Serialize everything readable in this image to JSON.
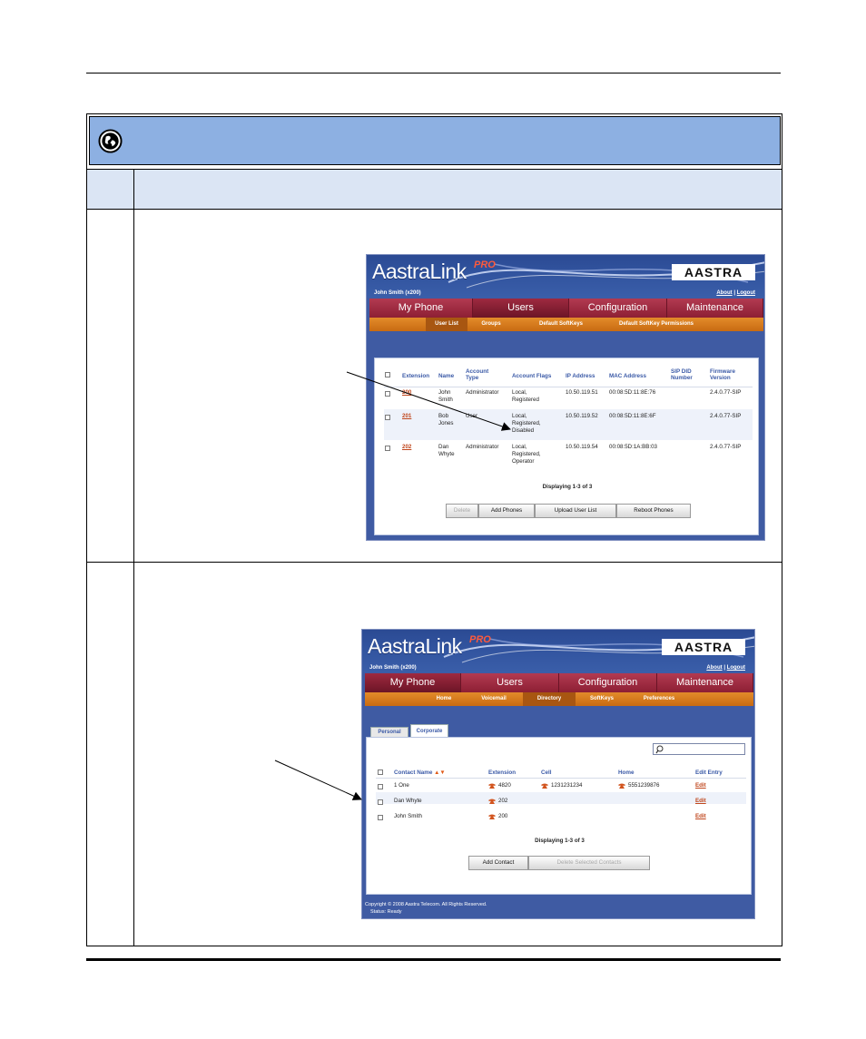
{
  "shot1": {
    "logo": "AastraLink",
    "logo_pro": "PRO",
    "brand": "AASTRA",
    "user": "John Smith (x200)",
    "about": "About",
    "sep": "|",
    "logout": "Logout",
    "nav": [
      "My Phone",
      "Users",
      "Configuration",
      "Maintenance"
    ],
    "subnav": [
      "User List",
      "Groups",
      "Default SoftKeys",
      "Default SoftKey Permissions"
    ],
    "columns": [
      "Extension",
      "Name",
      "Account Type",
      "Account Flags",
      "IP Address",
      "MAC Address",
      "SIP DID Number",
      "Firmware Version"
    ],
    "rows": [
      {
        "ext": "200",
        "name": "John Smith",
        "type": "Administrator",
        "flags": "Local, Registered",
        "ip": "10.50.119.51",
        "mac": "00:08:5D:11:8E:76",
        "fw": "2.4.0.77-SIP"
      },
      {
        "ext": "201",
        "name": "Bob Jones",
        "type": "User",
        "flags": "Local, Registered, Disabled",
        "ip": "10.50.119.52",
        "mac": "00:08:5D:11:8E:6F",
        "fw": "2.4.0.77-SIP"
      },
      {
        "ext": "202",
        "name": "Dan Whyte",
        "type": "Administrator",
        "flags": "Local, Registered, Operator",
        "ip": "10.50.119.54",
        "mac": "00:08:5D:1A:BB:03",
        "fw": "2.4.0.77-SIP"
      }
    ],
    "displaying": "Displaying 1-3 of 3",
    "buttons": [
      "Delete",
      "Add Phones",
      "Upload User List",
      "Reboot Phones"
    ]
  },
  "shot2": {
    "logo": "AastraLink",
    "logo_pro": "PRO",
    "brand": "AASTRA",
    "user": "John Smith (x200)",
    "about": "About",
    "sep": "|",
    "logout": "Logout",
    "nav": [
      "My Phone",
      "Users",
      "Configuration",
      "Maintenance"
    ],
    "subnav": [
      "Home",
      "Voicemail",
      "Directory",
      "SoftKeys",
      "Preferences"
    ],
    "tabs": [
      "Personal",
      "Corporate"
    ],
    "columns": [
      "Contact Name",
      "Extension",
      "Cell",
      "Home",
      "Edit Entry"
    ],
    "rows": [
      {
        "name": "1 One",
        "ext": "4820",
        "cell": "1231231234",
        "home": "5551239876",
        "edit": "Edit"
      },
      {
        "name": "Dan Whyte",
        "ext": "202",
        "cell": "",
        "home": "",
        "edit": "Edit"
      },
      {
        "name": "John Smith",
        "ext": "200",
        "cell": "",
        "home": "",
        "edit": "Edit"
      }
    ],
    "displaying": "Displaying 1-3 of 3",
    "buttons": [
      "Add Contact",
      "Delete Selected Contacts"
    ],
    "copyright": "Copyright © 2008 Aastra Telecom. All Rights Reserved.",
    "status": "Status: Ready"
  },
  "colors": {
    "banner": "#8db0e2",
    "header_row": "#dbe5f4",
    "nav_red": "#8d1f34",
    "subnav_orange": "#c86b12",
    "app_blue": "#3f5ba3",
    "link_orange": "#c0461c"
  }
}
